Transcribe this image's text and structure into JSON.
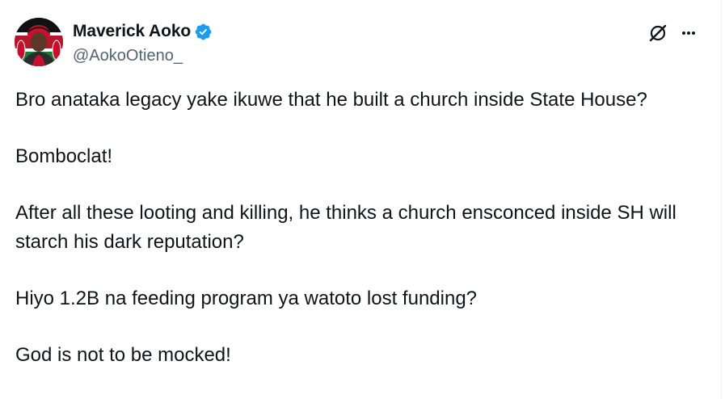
{
  "author": {
    "display_name": "Maverick Aoko",
    "handle": "@AokoOtieno_",
    "verified": true,
    "verified_color": "#1d9bf0"
  },
  "actions": {
    "grok_icon": "grok-icon",
    "more_icon": "more-icon"
  },
  "tweet": {
    "paragraphs": [
      "Bro anataka legacy yake ikuwe that he built a church inside State House?",
      "Bomboclat!",
      "After all these looting and killing, he thinks a church ensconced inside SH will starch his dark reputation?",
      "Hiyo 1.2B na feeding program ya watoto lost funding?",
      "God is not to be mocked!"
    ]
  },
  "colors": {
    "text": "#0f1419",
    "secondary_text": "#536471",
    "border": "#eff3f4"
  }
}
